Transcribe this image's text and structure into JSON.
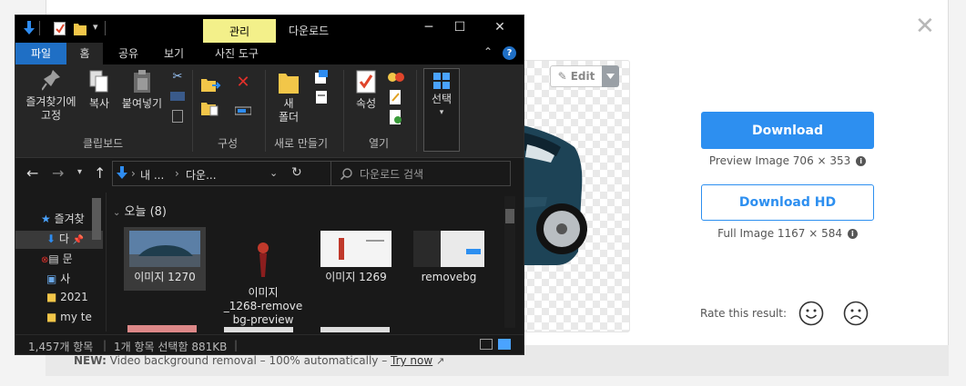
{
  "web": {
    "edit_label": "Edit",
    "download_label": "Download",
    "preview_info": "Preview Image 706 × 353",
    "download_hd_label": "Download HD",
    "full_info": "Full Image 1167 × 584",
    "rate_label": "Rate this result:",
    "new_prefix": "NEW:",
    "new_text": " Video background removal – 100% automatically – ",
    "try_now": "Try now",
    "accent": "#2d8ff0"
  },
  "explorer": {
    "manage_tab": "관리",
    "title": "다운로드",
    "ribbon_tabs": [
      "파일",
      "홈",
      "공유",
      "보기",
      "사진 도구"
    ],
    "ribbon": {
      "pin_label": "즐겨찾기에\n고정",
      "copy_label": "복사",
      "paste_label": "붙여넣기",
      "new_folder_label": "새\n폴더",
      "properties_label": "속성",
      "select_label": "선택",
      "group_clipboard": "클립보드",
      "group_organize": "구성",
      "group_new": "새로 만들기",
      "group_open": "열기"
    },
    "address": {
      "seg1": "내 ...",
      "seg2": "다운..."
    },
    "search_placeholder": "다운로드 검색",
    "nav_items": [
      "즐겨찾",
      "다",
      "문",
      "사",
      "2021",
      "my te"
    ],
    "section_header": "오늘 (8)",
    "files": [
      {
        "name": "이미지 1270"
      },
      {
        "name": "이미지\n_1268-remove\nbg-preview"
      },
      {
        "name": "이미지 1269"
      },
      {
        "name": "removebg"
      }
    ],
    "status": {
      "items": "1,457개 항목",
      "selected": "1개 항목 선택함 881KB"
    }
  }
}
